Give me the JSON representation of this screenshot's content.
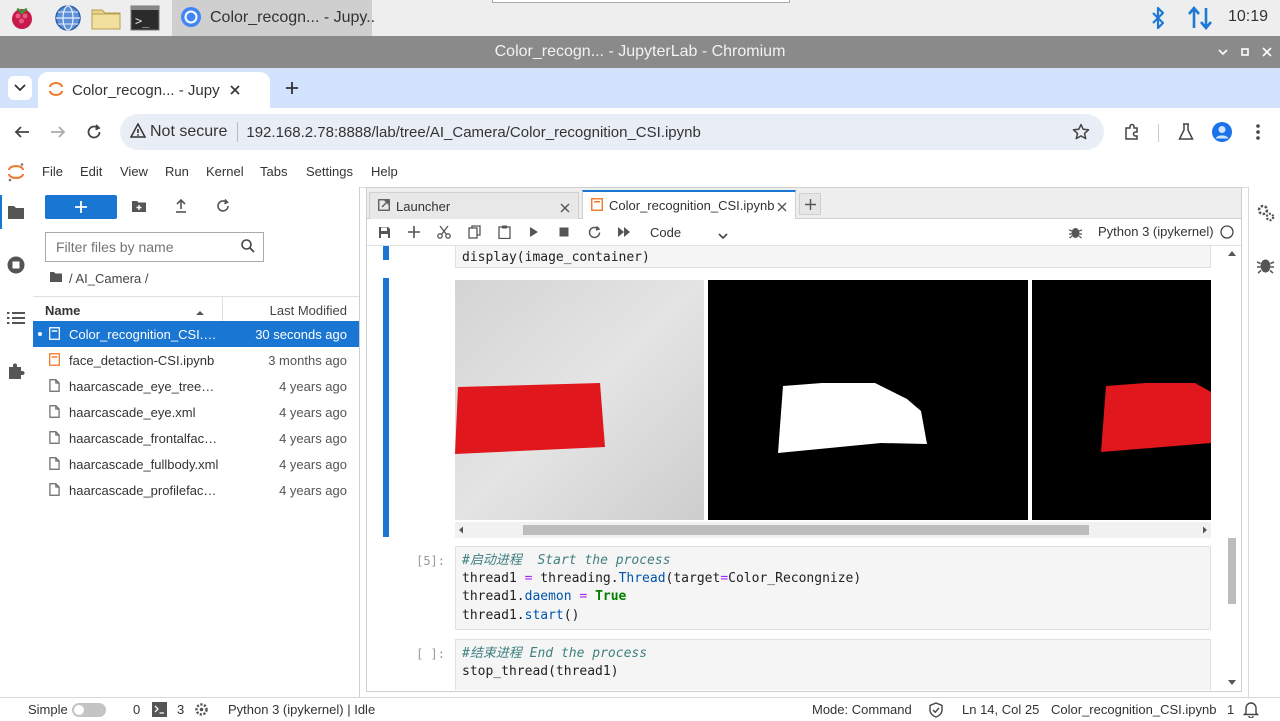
{
  "taskbar": {
    "chromium_task_label": "Color_recogn... - Jupy..",
    "clock": "10:19"
  },
  "window": {
    "title": "Color_recogn... - JupyterLab - Chromium"
  },
  "browser": {
    "tab_title": "Color_recogn... - Jupyter",
    "security_label": "Not secure",
    "url": "192.168.2.78:8888/lab/tree/AI_Camera/Color_recognition_CSI.ipynb"
  },
  "menu": [
    "File",
    "Edit",
    "View",
    "Run",
    "Kernel",
    "Tabs",
    "Settings",
    "Help"
  ],
  "file_browser": {
    "filter_placeholder": "Filter files by name",
    "breadcrumb": "/ AI_Camera /",
    "col_name": "Name",
    "col_modified": "Last Modified",
    "files": [
      {
        "name": "Color_recognition_CSI.ipynb",
        "modified": "30 seconds ago",
        "type": "notebook",
        "selected": true
      },
      {
        "name": "face_detaction-CSI.ipynb",
        "modified": "3 months ago",
        "type": "notebook",
        "selected": false
      },
      {
        "name": "haarcascade_eye_tree_eyeglasses.xml",
        "modified": "4 years ago",
        "type": "file",
        "selected": false
      },
      {
        "name": "haarcascade_eye.xml",
        "modified": "4 years ago",
        "type": "file",
        "selected": false
      },
      {
        "name": "haarcascade_frontalface_default.xml",
        "modified": "4 years ago",
        "type": "file",
        "selected": false
      },
      {
        "name": "haarcascade_fullbody.xml",
        "modified": "4 years ago",
        "type": "file",
        "selected": false
      },
      {
        "name": "haarcascade_profileface.xml",
        "modified": "4 years ago",
        "type": "file",
        "selected": false
      }
    ]
  },
  "doc_tabs": [
    {
      "label": "Launcher",
      "active": false
    },
    {
      "label": "Color_recognition_CSI.ipynb",
      "active": true
    }
  ],
  "notebook_toolbar": {
    "cell_type": "Code",
    "kernel": "Python 3 (ipykernel)"
  },
  "cells": {
    "cell_top_last_line": "display(image_container)",
    "cell5": {
      "prompt": "[5]:",
      "comment": "#启动进程  Start the process",
      "l2_var": "thread1",
      "l2_eq": "=",
      "l2_mod": "threading.",
      "l2_cls": "Thread",
      "l2_open": "(target",
      "l2_eq2": "=",
      "l2_arg": "Color_Recongnize)",
      "l3_var": "thread1.",
      "l3_attr": "daemon",
      "l3_eq": "=",
      "l3_val": "True",
      "l4_var": "thread1.",
      "l4_attr": "start",
      "l4_rest": "()"
    },
    "cell6": {
      "prompt": "[ ]:",
      "comment": "#结束进程 End the process",
      "line2": "stop_thread(thread1)"
    }
  },
  "statusbar": {
    "mode_label": "Simple",
    "terminals_count": "0",
    "kernels_count": "3",
    "kernel_status": "Python 3 (ipykernel) | Idle",
    "command_mode": "Mode: Command",
    "cursor_pos": "Ln 14, Col 25",
    "file_name": "Color_recognition_CSI.ipynb",
    "notifications_count": "1"
  },
  "colors": {
    "accent": "#1976d2",
    "selected_row": "#1976d2",
    "titlebar": "#8a8a8a",
    "tabstrip": "#d3e3fd"
  }
}
